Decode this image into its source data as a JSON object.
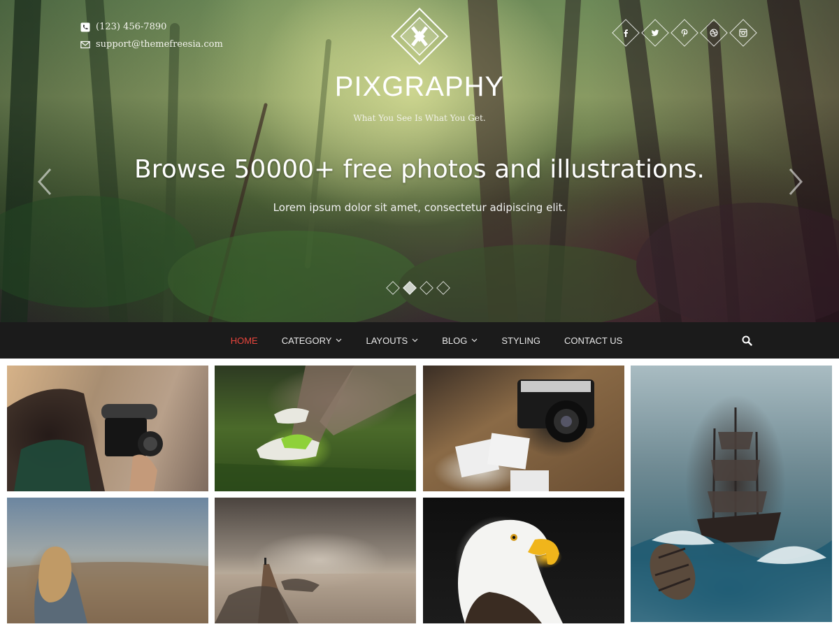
{
  "header": {
    "phone": "(123) 456-7890",
    "email": "support@themefreesia.com",
    "site_title": "PIXGRAPHY",
    "tagline": "What You See Is What You Get.",
    "social_icons": [
      "facebook-icon",
      "twitter-icon",
      "pinterest-icon",
      "dribbble-icon",
      "instagram-icon"
    ]
  },
  "slider": {
    "headline": "Browse 50000+ free photos and illustrations.",
    "subline": "Lorem ipsum dolor sit amet, consectetur adipiscing elit.",
    "active_slide": 2,
    "slide_count": 4
  },
  "nav": {
    "items": [
      {
        "label": "HOME",
        "active": true,
        "dropdown": false
      },
      {
        "label": "CATEGORY",
        "active": false,
        "dropdown": true
      },
      {
        "label": "LAYOUTS",
        "active": false,
        "dropdown": true
      },
      {
        "label": "BLOG",
        "active": false,
        "dropdown": true
      },
      {
        "label": "STYLING",
        "active": false,
        "dropdown": false
      },
      {
        "label": "CONTACT US",
        "active": false,
        "dropdown": false
      }
    ]
  },
  "colors": {
    "accent": "#e8453c",
    "nav_bg": "#1b1b1b",
    "text_light": "#ffffff"
  },
  "gallery": {
    "tiles": [
      "videographer-photo",
      "sneakers-grass-photo",
      "vintage-camera-photo",
      "pirate-ship-storm-photo",
      "woman-cliff-photo",
      "pier-sea-photo",
      "bald-eagle-photo"
    ]
  }
}
